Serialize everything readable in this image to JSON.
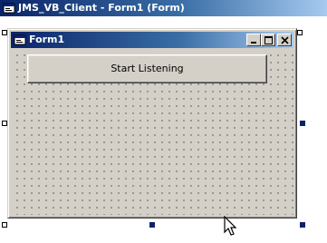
{
  "ide_window": {
    "title": "JMS_VB_Client - Form1 (Form)",
    "icon": "form-icon"
  },
  "form1": {
    "title": "Form1",
    "icon": "form-icon",
    "caption_buttons": {
      "minimize": "minimize-icon",
      "maximize": "maximize-icon",
      "close": "close-icon"
    },
    "start_button_label": "Start Listening",
    "grid": "dotted"
  },
  "colors": {
    "titlebar_active_start": "#0a246a",
    "titlebar_active_end": "#a6caf0",
    "face": "#d4d0c8",
    "handle_selected": "#0a246a"
  }
}
